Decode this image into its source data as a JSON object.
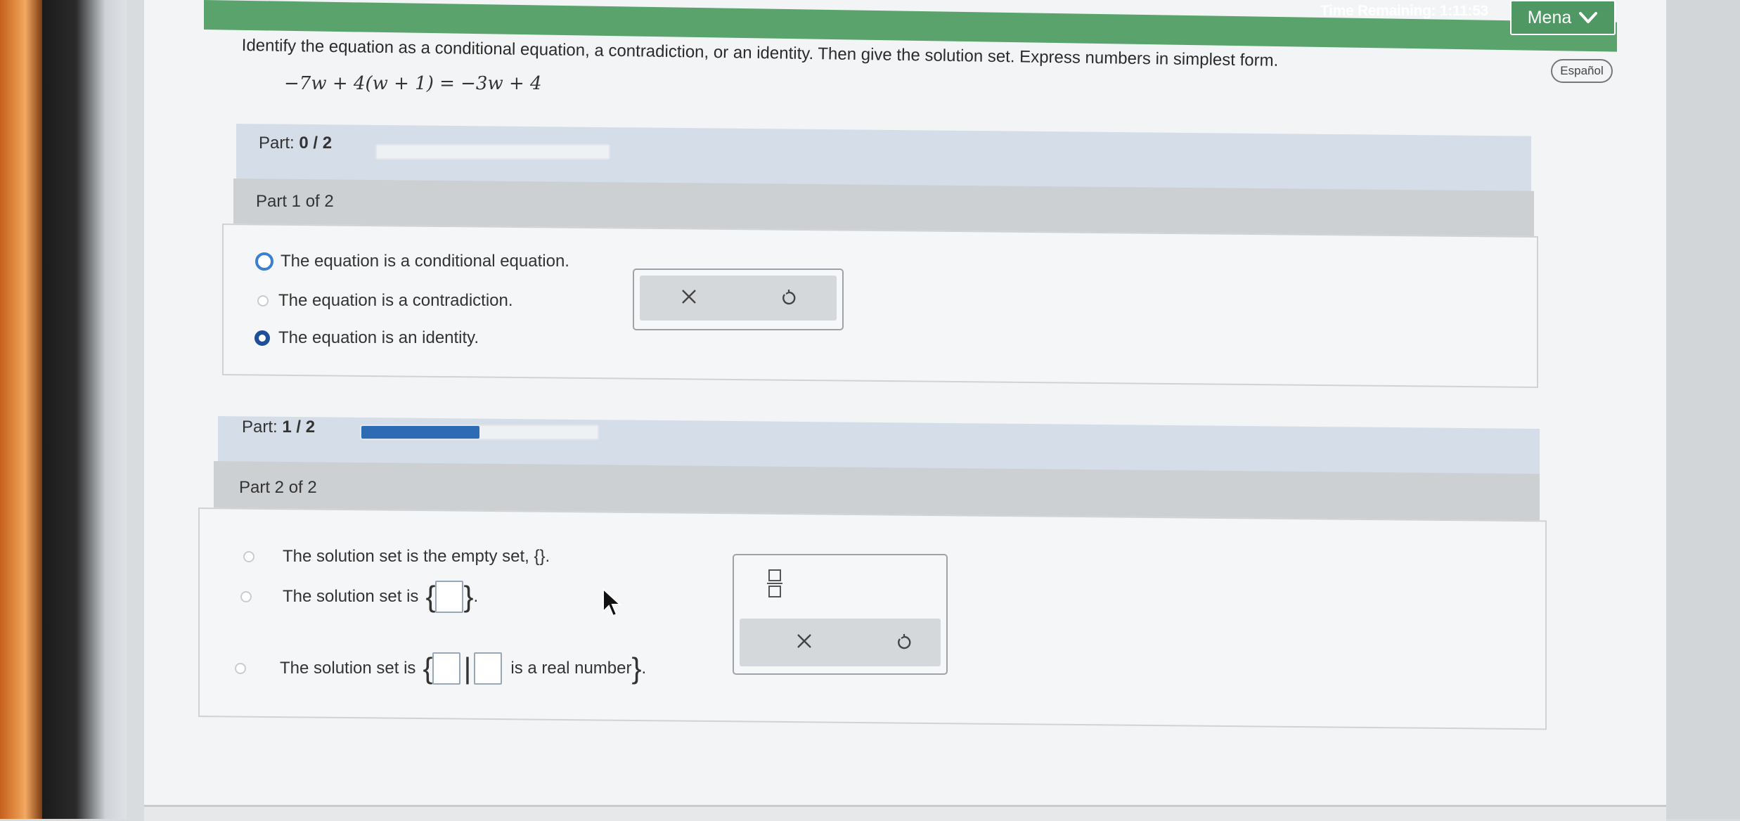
{
  "header": {
    "timer_label": "Time Remaining: 1:11:53",
    "menu_label": "Mena",
    "language_button": "Español"
  },
  "question": {
    "prompt": "Identify the equation as a conditional equation, a contradiction, or an identity. Then give the solution set. Express numbers in simplest form.",
    "equation": "−7w + 4(w + 1) = −3w + 4"
  },
  "progress_1": {
    "prefix": "Part: ",
    "value": "0 / 2",
    "fraction": 0.0
  },
  "part1": {
    "title": "Part 1 of 2",
    "options": [
      "The equation is a conditional equation.",
      "The equation is a contradiction.",
      "The equation is an identity."
    ],
    "selected_index": 2
  },
  "progress_2": {
    "prefix": "Part: ",
    "value": "1 / 2",
    "fraction": 0.5
  },
  "part2": {
    "title": "Part 2 of 2",
    "option_empty": "The solution set is the empty set, {}.",
    "option_single_prefix": "The solution set is",
    "option_builder_prefix": "The solution set is",
    "option_builder_mid": "is a real number"
  },
  "tools": {
    "clear_symbol": "×",
    "undo_symbol": "↺"
  },
  "colors": {
    "header_green": "#5aa36d",
    "progress_blue": "#2e6bb5",
    "selected_radio": "#1e4f9a"
  }
}
